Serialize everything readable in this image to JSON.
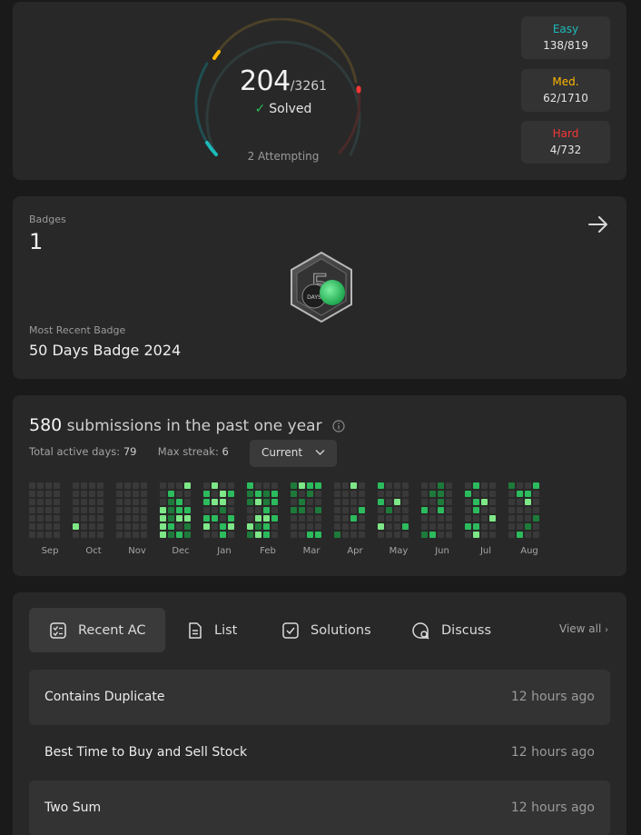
{
  "progress": {
    "solved": "204",
    "total": "/3261",
    "solved_label": "Solved",
    "attempting": "2 Attempting",
    "difficulties": [
      {
        "label": "Easy",
        "count": "138/819",
        "color": "#1cbaba"
      },
      {
        "label": "Med.",
        "count": "62/1710",
        "color": "#ffb700"
      },
      {
        "label": "Hard",
        "count": "4/732",
        "color": "#f63737"
      }
    ]
  },
  "badges": {
    "label": "Badges",
    "count": "1",
    "badge_text": "DAYS",
    "recent_label": "Most Recent Badge",
    "recent_name": "50 Days Badge 2024"
  },
  "submissions": {
    "count": "580",
    "title_rest": "submissions in the past one year",
    "active_days_label": "Total active days:",
    "active_days": "79",
    "max_streak_label": "Max streak:",
    "max_streak": "6",
    "selector": "Current",
    "months": [
      "Sep",
      "Oct",
      "Nov",
      "Dec",
      "Jan",
      "Feb",
      "Mar",
      "Apr",
      "May",
      "Jun",
      "Jul",
      "Aug"
    ],
    "colors": {
      "empty": "#393939",
      "l1": "#0e4429",
      "l2": "#1e7a3a",
      "l3": "#2cbb5d",
      "l4": "#7ee787"
    }
  },
  "recent": {
    "tabs": [
      {
        "label": "Recent AC",
        "icon": "recent-ac-icon"
      },
      {
        "label": "List",
        "icon": "list-icon"
      },
      {
        "label": "Solutions",
        "icon": "solutions-icon"
      },
      {
        "label": "Discuss",
        "icon": "discuss-icon"
      }
    ],
    "view_all": "View all",
    "items": [
      {
        "title": "Contains Duplicate",
        "time": "12 hours ago"
      },
      {
        "title": "Best Time to Buy and Sell Stock",
        "time": "12 hours ago"
      },
      {
        "title": "Two Sum",
        "time": "12 hours ago"
      }
    ]
  }
}
